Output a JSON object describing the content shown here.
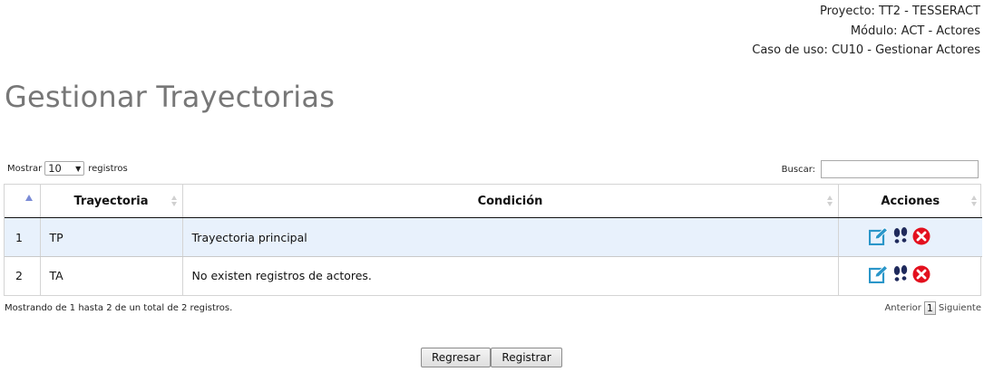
{
  "header": {
    "project": "Proyecto: TT2 - TESSERACT",
    "module": "Módulo: ACT - Actores",
    "use_case": "Caso de uso: CU10 - Gestionar Actores"
  },
  "page_title": "Gestionar Trayectorias",
  "length_menu": {
    "prefix": "Mostrar",
    "value": "10",
    "suffix": "registros"
  },
  "search": {
    "label": "Buscar:",
    "value": "",
    "placeholder": ""
  },
  "table": {
    "columns": [
      "",
      "Trayectoria",
      "Condición",
      "Acciones"
    ],
    "rows": [
      {
        "num": "1",
        "trayectoria": "TP",
        "condicion": "Trayectoria principal"
      },
      {
        "num": "2",
        "trayectoria": "TA",
        "condicion": "No existen registros de actores."
      }
    ],
    "action_icons": [
      "edit-icon",
      "footprints-icon",
      "delete-icon"
    ]
  },
  "info": "Mostrando de 1 hasta 2 de un total de 2 registros.",
  "pagination": {
    "previous": "Anterior",
    "current": "1",
    "next": "Siguiente"
  },
  "buttons": {
    "back": "Regresar",
    "register": "Registrar"
  },
  "colors": {
    "edit": "#2a96c9",
    "footprints": "#1f2a5c",
    "delete": "#e3101e",
    "selected_row": "#e8f1fc"
  }
}
